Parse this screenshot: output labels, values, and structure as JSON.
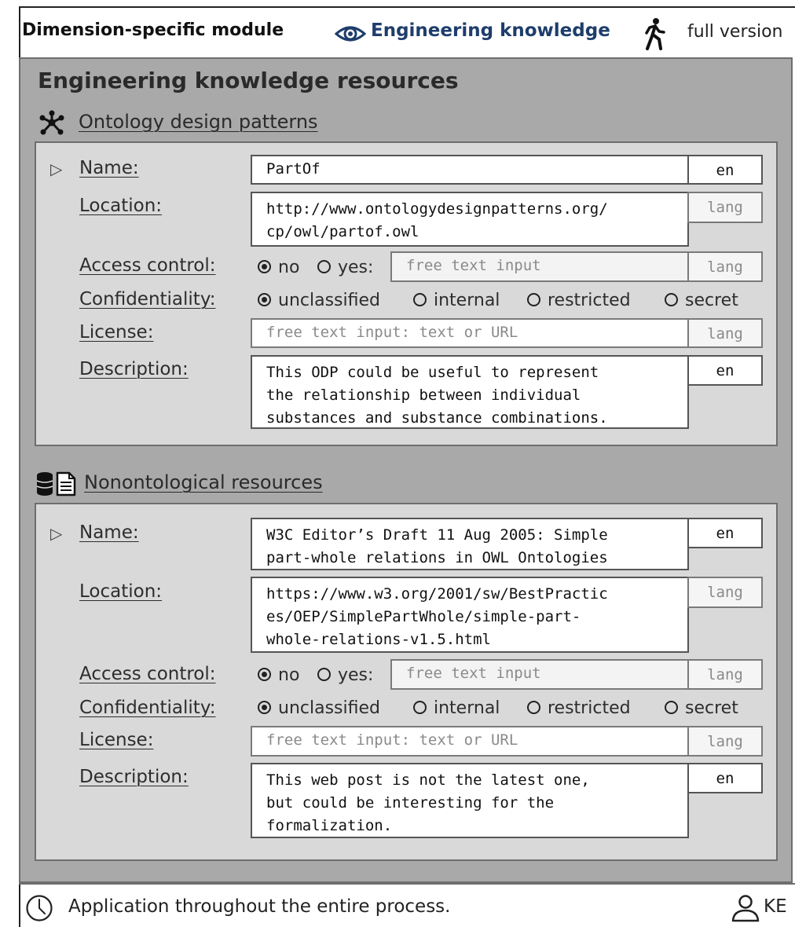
{
  "header": {
    "title": "Dimension-specific module",
    "perspective_icon": "eye-icon",
    "perspective": "Engineering knowledge",
    "version_icon": "walking-person-icon",
    "version": "full version",
    "perspective_color": "#1e3d6b"
  },
  "panel": {
    "title": "Engineering knowledge resources",
    "background": "#a9a9a9",
    "inner_background": "#d9d9d9"
  },
  "sections": [
    {
      "icon": "network-node-icon",
      "heading": "Ontology design patterns",
      "labels": {
        "name": "Name:",
        "location": "Location:",
        "access": "Access control:",
        "confidentiality": "Confidentiality:",
        "license": "License:",
        "description": "Description:"
      },
      "name": {
        "value": "PartOf",
        "lang": "en"
      },
      "location": {
        "value": "http://www.ontologydesignpatterns.org/\ncp/owl/partof.owl",
        "lang": "lang"
      },
      "access_control": {
        "options": [
          "no",
          "yes:"
        ],
        "selected": "no",
        "placeholder": "free text input",
        "lang": "lang"
      },
      "confidentiality": {
        "options": [
          "unclassified",
          "internal",
          "restricted",
          "secret"
        ],
        "selected": "unclassified"
      },
      "license": {
        "placeholder": "free text input: text or URL",
        "lang": "lang"
      },
      "description": {
        "value": "This ODP could be useful to represent\nthe relationship between individual\nsubstances and substance combinations.",
        "lang": "en"
      }
    },
    {
      "icon": "database-document-icon",
      "heading": "Nonontological resources",
      "labels": {
        "name": "Name:",
        "location": "Location:",
        "access": "Access control:",
        "confidentiality": "Confidentiality:",
        "license": "License:",
        "description": "Description:"
      },
      "name": {
        "value": "W3C Editor’s Draft 11 Aug 2005: Simple\npart-whole relations in OWL Ontologies",
        "lang": "en"
      },
      "location": {
        "value": "https://www.w3.org/2001/sw/BestPractic\nes/OEP/SimplePartWhole/simple-part-\nwhole-relations-v1.5.html",
        "lang": "lang"
      },
      "access_control": {
        "options": [
          "no",
          "yes:"
        ],
        "selected": "no",
        "placeholder": "free text input",
        "lang": "lang"
      },
      "confidentiality": {
        "options": [
          "unclassified",
          "internal",
          "restricted",
          "secret"
        ],
        "selected": "unclassified"
      },
      "license": {
        "placeholder": "free text input: text or URL",
        "lang": "lang"
      },
      "description": {
        "value": "This web post is not the latest one,\nbut could be interesting for the\nformalization.",
        "lang": "en"
      }
    }
  ],
  "footer": {
    "timing_icon": "clock-icon",
    "timing": "Application throughout the entire process.",
    "role_icon": "user-icon",
    "role": "KE"
  }
}
